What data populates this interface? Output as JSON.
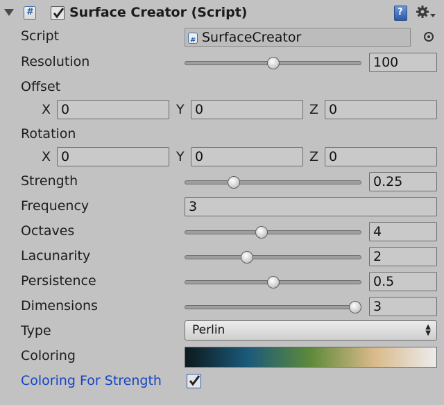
{
  "header": {
    "title": "Surface Creator (Script)",
    "enabled": true
  },
  "fields": {
    "script": {
      "label": "Script",
      "value": "SurfaceCreator"
    },
    "resolution": {
      "label": "Resolution",
      "value": "100",
      "fraction": 0.5
    },
    "offset": {
      "label": "Offset",
      "x_label": "X",
      "y_label": "Y",
      "z_label": "Z",
      "x": "0",
      "y": "0",
      "z": "0"
    },
    "rotation": {
      "label": "Rotation",
      "x_label": "X",
      "y_label": "Y",
      "z_label": "Z",
      "x": "0",
      "y": "0",
      "z": "0"
    },
    "strength": {
      "label": "Strength",
      "value": "0.25",
      "fraction": 0.26
    },
    "frequency": {
      "label": "Frequency",
      "value": "3"
    },
    "octaves": {
      "label": "Octaves",
      "value": "4",
      "fraction": 0.43
    },
    "lacunarity": {
      "label": "Lacunarity",
      "value": "2",
      "fraction": 0.34
    },
    "persistence": {
      "label": "Persistence",
      "value": "0.5",
      "fraction": 0.5
    },
    "dimensions": {
      "label": "Dimensions",
      "value": "3",
      "fraction": 1.0
    },
    "type": {
      "label": "Type",
      "value": "Perlin"
    },
    "coloring": {
      "label": "Coloring",
      "gradient_colors": [
        "#0c1a1c",
        "#1b5a7a",
        "#5f8a3a",
        "#d9b98a",
        "#ececec"
      ]
    },
    "coloring_for_strength": {
      "label": "Coloring For Strength",
      "checked": true
    }
  },
  "colors": {
    "background": "#c2c2c2",
    "link": "#1644c4"
  }
}
